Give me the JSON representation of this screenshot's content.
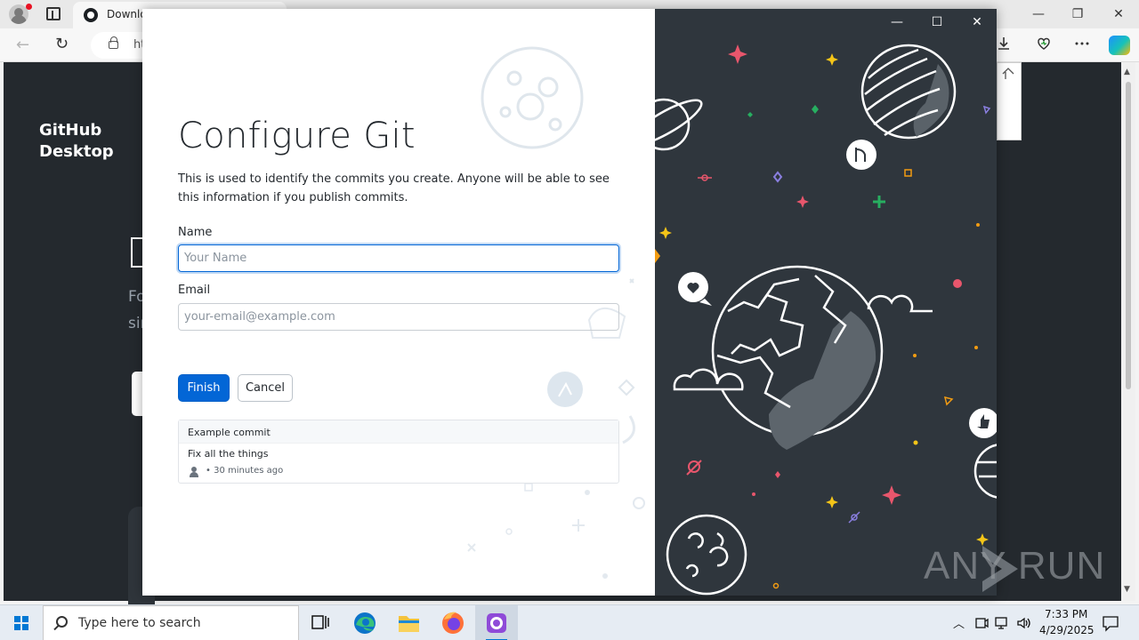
{
  "browser": {
    "tab_title": "Download GitHub Desktop",
    "url_fragment": "ht",
    "window_controls": {
      "minimize": "—",
      "restore": "❐",
      "close": "✕"
    }
  },
  "page": {
    "logo_line1": "GitHub",
    "logo_line2": "Desktop",
    "fragment1": "Fo",
    "fragment2": "sir"
  },
  "dialog": {
    "title": "Configure Git",
    "description": "This is used to identify the commits you create. Anyone will be able to see this information if you publish commits.",
    "name_label": "Name",
    "name_placeholder": "Your Name",
    "name_value": "",
    "email_label": "Email",
    "email_placeholder": "your-email@example.com",
    "email_value": "",
    "finish_label": "Finish",
    "cancel_label": "Cancel",
    "example": {
      "header": "Example commit",
      "summary": "Fix all the things",
      "meta": "• 30 minutes ago"
    },
    "window_controls": {
      "minimize": "—",
      "maximize": "☐",
      "close": "✕"
    }
  },
  "taskbar": {
    "search_placeholder": "Type here to search",
    "time": "7:33 PM",
    "date": "4/29/2025",
    "apps": [
      "task-view",
      "edge",
      "file-explorer",
      "firefox",
      "github-desktop"
    ],
    "active_app": "github-desktop"
  },
  "watermark": {
    "text": "ANY RUN"
  },
  "colors": {
    "accent": "#0366d6",
    "dialog_art_bg": "#2f363d",
    "page_bg": "#24292e",
    "taskbar_bg": "#e6ecf3"
  }
}
